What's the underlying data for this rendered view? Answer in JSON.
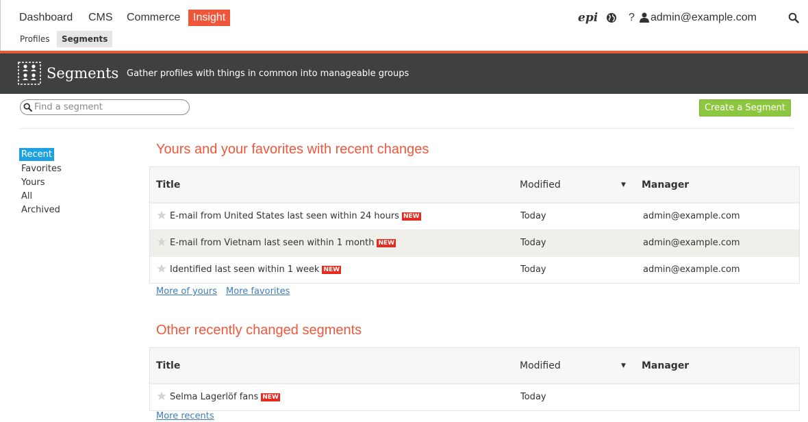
{
  "nav": {
    "products": [
      "Dashboard",
      "CMS",
      "Commerce",
      "Insight"
    ],
    "subtabs": [
      "Profiles",
      "Segments"
    ],
    "logo": "epi",
    "help": "?",
    "user": "admin@example.com"
  },
  "banner": {
    "title": "Segments",
    "subtitle": "Gather profiles with things in common into manageable groups"
  },
  "search": {
    "placeholder": "Find a segment",
    "value": ""
  },
  "create_button": "Create a Segment",
  "sidebar": [
    "Recent",
    "Favorites",
    "Yours",
    "All",
    "Archived"
  ],
  "sections": [
    {
      "title": "Yours and your favorites with recent changes",
      "columns": [
        "Title",
        "Modified",
        "Manager"
      ],
      "rows": [
        {
          "name": "E-mail from United States last seen within 24 hours",
          "badge": "NEW",
          "modified": "Today",
          "manager": "admin@example.com"
        },
        {
          "name": "E-mail from Vietnam last seen within 1 month",
          "badge": "NEW",
          "modified": "Today",
          "manager": "admin@example.com"
        },
        {
          "name": "Identified last seen within 1 week",
          "badge": "NEW",
          "modified": "Today",
          "manager": "admin@example.com"
        }
      ],
      "links": [
        "More of yours",
        "More favorites"
      ]
    },
    {
      "title": "Other recently changed segments",
      "columns": [
        "Title",
        "Modified",
        "Manager"
      ],
      "rows": [
        {
          "name": "Selma Lagerlöf fans",
          "badge": "NEW",
          "modified": "Today",
          "manager": ""
        }
      ],
      "links": [
        "More recents"
      ]
    }
  ],
  "colors": {
    "accent": "#f0573a",
    "banner": "#3f4040",
    "create_button": "#8dc63f",
    "sidebar_active": "#1ea1e0",
    "badge": "#e52a1f",
    "link": "#3d7dbb"
  }
}
